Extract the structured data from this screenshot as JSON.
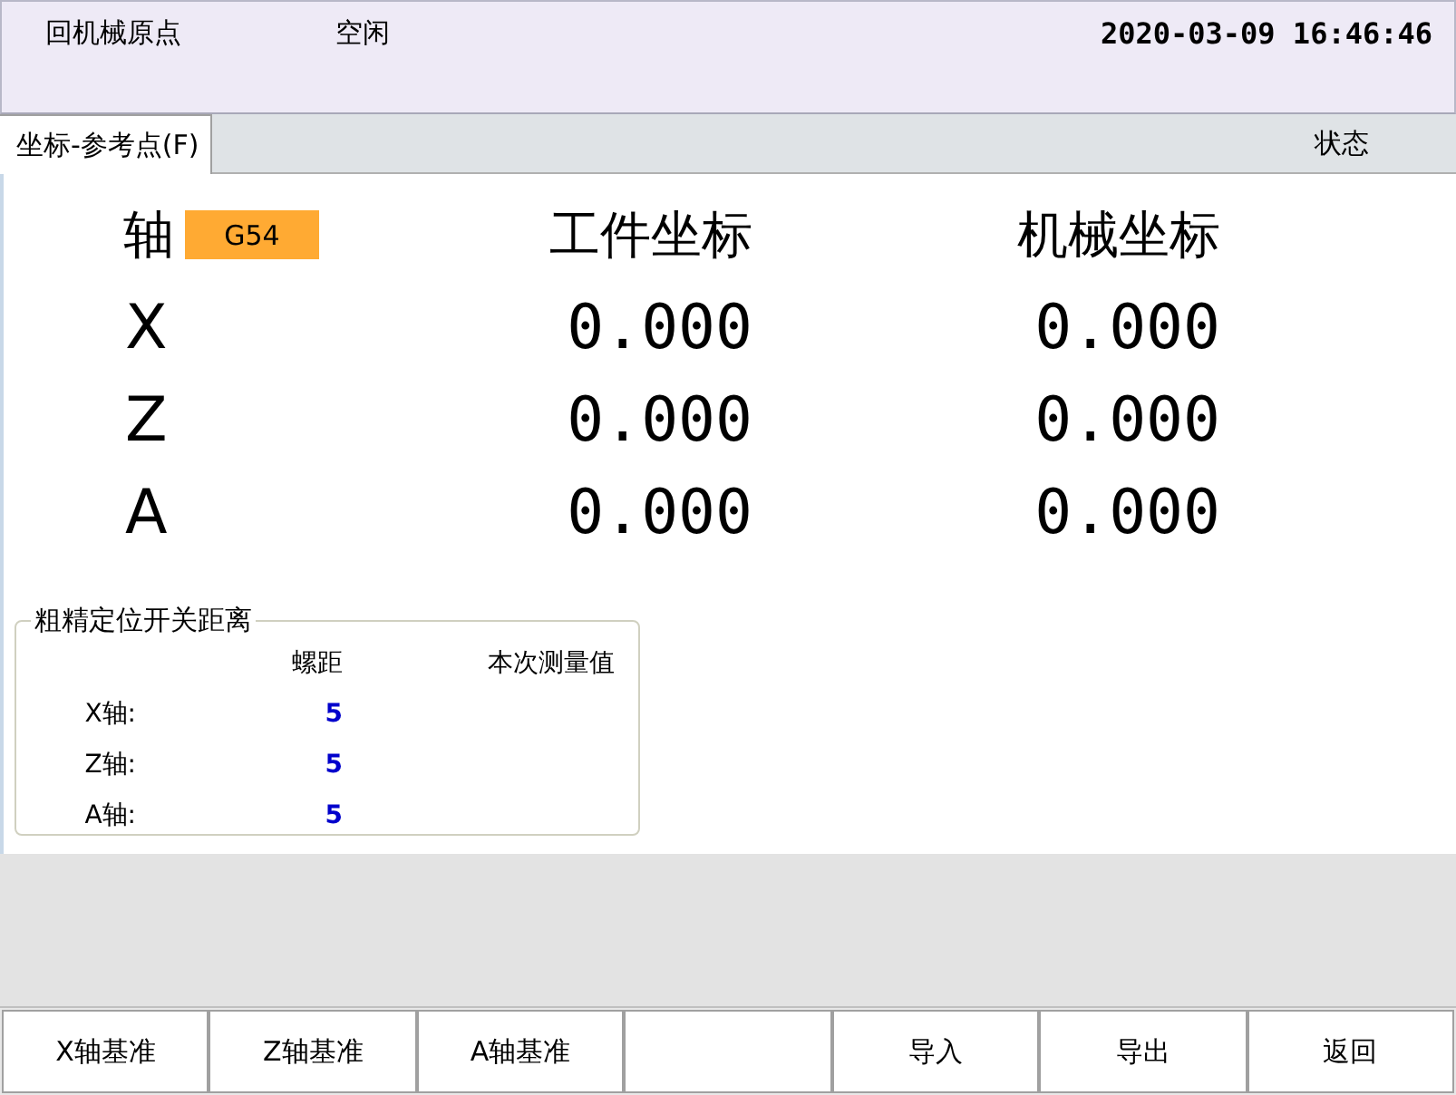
{
  "status_bar": {
    "mode": "回机械原点",
    "state": "空闲",
    "datetime": "2020-03-09 16:46:46"
  },
  "tabs": [
    {
      "label": "坐标-参考点(F)",
      "selected": true
    }
  ],
  "status_label": "状态",
  "coordinates": {
    "axis_header": "轴",
    "coordinate_system": "G54",
    "work_header": "工件坐标",
    "machine_header": "机械坐标",
    "rows": [
      {
        "axis": "X",
        "work": "0.000",
        "machine": "0.000"
      },
      {
        "axis": "Z",
        "work": "0.000",
        "machine": "0.000"
      },
      {
        "axis": "A",
        "work": "0.000",
        "machine": "0.000"
      }
    ]
  },
  "distance_group": {
    "title": "粗精定位开关距离",
    "columns": [
      "螺距",
      "本次测量值"
    ],
    "rows": [
      {
        "label": "X轴:",
        "pitch": "5"
      },
      {
        "label": "Z轴:",
        "pitch": "5"
      },
      {
        "label": "A轴:",
        "pitch": "5"
      }
    ]
  },
  "buttons": [
    {
      "kind": "button",
      "label": "X轴基准"
    },
    {
      "kind": "button",
      "label": "Z轴基准"
    },
    {
      "kind": "button",
      "label": "A轴基准"
    },
    {
      "kind": "blank"
    },
    {
      "kind": "button",
      "label": "导入"
    },
    {
      "kind": "button",
      "label": "导出"
    },
    {
      "kind": "button",
      "label": "返回"
    }
  ]
}
